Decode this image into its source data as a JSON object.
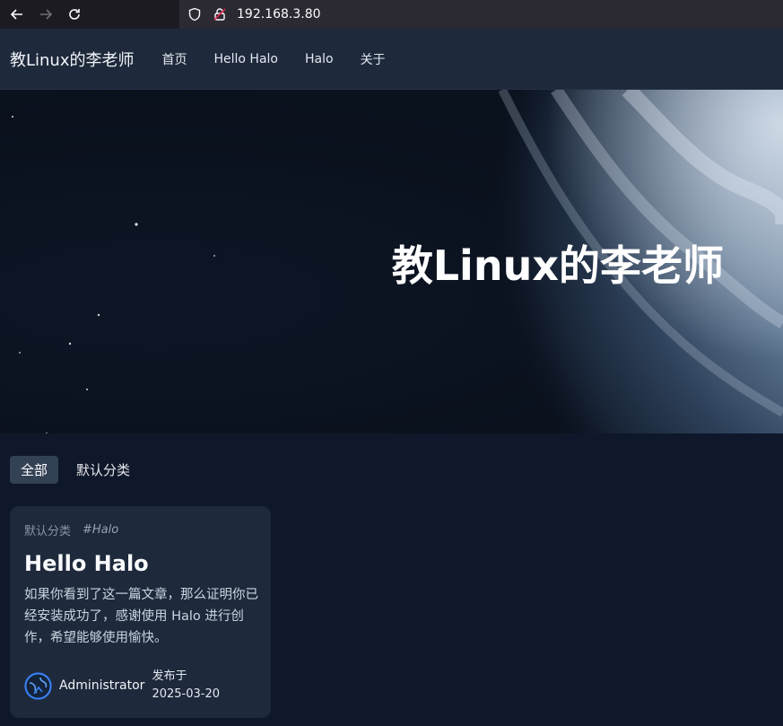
{
  "browser": {
    "url": "192.168.3.80"
  },
  "header": {
    "site_title": "教Linux的李老师",
    "menu": [
      {
        "label": "首页"
      },
      {
        "label": "Hello Halo"
      },
      {
        "label": "Halo"
      },
      {
        "label": "关于"
      }
    ]
  },
  "hero": {
    "title": "教Linux的李老师"
  },
  "categories": {
    "tabs": [
      {
        "label": "全部",
        "active": true
      },
      {
        "label": "默认分类",
        "active": false
      }
    ]
  },
  "post": {
    "category": "默认分类",
    "tag": "#Halo",
    "title": "Hello Halo",
    "excerpt": "如果你看到了这一篇文章，那么证明你已经安装成功了，感谢使用 Halo 进行创作，希望能够使用愉快。",
    "author": "Administrator",
    "published_label": "发布于",
    "published_date": "2025-03-20"
  },
  "colors": {
    "header_bg": "#1e293b",
    "page_bg": "#0f172a",
    "tab_active_bg": "#334155",
    "card_bg": "#1e293b"
  }
}
